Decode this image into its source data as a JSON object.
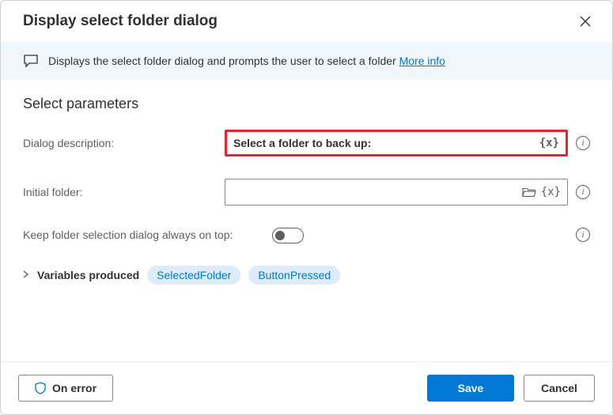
{
  "header": {
    "title": "Display select folder dialog"
  },
  "banner": {
    "text": "Displays the select folder dialog and prompts the user to select a folder ",
    "link_label": "More info"
  },
  "section": {
    "title": "Select parameters"
  },
  "fields": {
    "dialog_description": {
      "label": "Dialog description:",
      "value": "Select a folder to back up:"
    },
    "initial_folder": {
      "label": "Initial folder:",
      "value": ""
    },
    "always_on_top": {
      "label": "Keep folder selection dialog always on top:",
      "value": false
    }
  },
  "variables": {
    "label": "Variables produced",
    "items": [
      "SelectedFolder",
      "ButtonPressed"
    ]
  },
  "footer": {
    "on_error": "On error",
    "save": "Save",
    "cancel": "Cancel"
  },
  "tokens": {
    "var_insert": "{x}"
  }
}
